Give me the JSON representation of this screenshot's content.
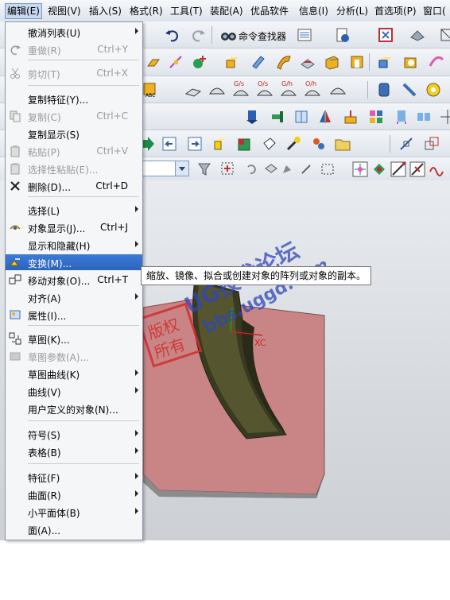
{
  "menubar": {
    "items": [
      "编辑(E)",
      "视图(V)",
      "插入(S)",
      "格式(R)",
      "工具(T)",
      "装配(A)",
      "优品软件",
      "信息(I)",
      "分析(L)",
      "首选项(P)",
      "窗口("
    ]
  },
  "toolbar": {
    "command_finder": "命令查找器"
  },
  "edit_menu": {
    "items": [
      {
        "label": "撤消列表(U)",
        "shortcut": "",
        "submenu": true,
        "disabled": false,
        "icon": ""
      },
      {
        "label": "重做(R)",
        "shortcut": "Ctrl+Y",
        "submenu": false,
        "disabled": true,
        "icon": "redo-icon"
      },
      {
        "label": "剪切(T)",
        "shortcut": "Ctrl+X",
        "submenu": false,
        "disabled": true,
        "icon": "cut-icon"
      },
      {
        "label": "复制特征(Y)...",
        "shortcut": "",
        "submenu": false,
        "disabled": false,
        "icon": ""
      },
      {
        "label": "复制(C)",
        "shortcut": "Ctrl+C",
        "submenu": false,
        "disabled": true,
        "icon": "copy-icon"
      },
      {
        "label": "复制显示(S)",
        "shortcut": "",
        "submenu": false,
        "disabled": false,
        "icon": ""
      },
      {
        "label": "粘贴(P)",
        "shortcut": "Ctrl+V",
        "submenu": false,
        "disabled": true,
        "icon": "paste-icon"
      },
      {
        "label": "选择性粘贴(E)...",
        "shortcut": "",
        "submenu": false,
        "disabled": true,
        "icon": "paste-special-icon"
      },
      {
        "label": "删除(D)...",
        "shortcut": "Ctrl+D",
        "submenu": false,
        "disabled": false,
        "icon": "delete-icon"
      },
      {
        "label": "选择(L)",
        "shortcut": "",
        "submenu": true,
        "disabled": false,
        "icon": ""
      },
      {
        "label": "对象显示(J)...",
        "shortcut": "Ctrl+J",
        "submenu": false,
        "disabled": false,
        "icon": "object-display-icon"
      },
      {
        "label": "显示和隐藏(H)",
        "shortcut": "",
        "submenu": true,
        "disabled": false,
        "icon": ""
      },
      {
        "label": "变换(M)...",
        "shortcut": "",
        "submenu": false,
        "disabled": false,
        "icon": "transform-icon",
        "highlighted": true
      },
      {
        "label": "移动对象(O)...",
        "shortcut": "Ctrl+T",
        "submenu": false,
        "disabled": false,
        "icon": "move-object-icon"
      },
      {
        "label": "对齐(A)",
        "shortcut": "",
        "submenu": true,
        "disabled": false,
        "icon": ""
      },
      {
        "label": "属性(I)...",
        "shortcut": "",
        "submenu": false,
        "disabled": false,
        "icon": "properties-icon"
      },
      {
        "label": "草图(K)...",
        "shortcut": "",
        "submenu": false,
        "disabled": false,
        "icon": "sketch-icon"
      },
      {
        "label": "草图参数(A)...",
        "shortcut": "",
        "submenu": false,
        "disabled": true,
        "icon": "sketch-params-icon"
      },
      {
        "label": "草图曲线(K)",
        "shortcut": "",
        "submenu": true,
        "disabled": false,
        "icon": ""
      },
      {
        "label": "曲线(V)",
        "shortcut": "",
        "submenu": true,
        "disabled": false,
        "icon": ""
      },
      {
        "label": "用户定义的对象(N)...",
        "shortcut": "",
        "submenu": false,
        "disabled": false,
        "icon": ""
      },
      {
        "label": "符号(S)",
        "shortcut": "",
        "submenu": true,
        "disabled": false,
        "icon": ""
      },
      {
        "label": "表格(B)",
        "shortcut": "",
        "submenu": true,
        "disabled": false,
        "icon": ""
      },
      {
        "label": "特征(F)",
        "shortcut": "",
        "submenu": true,
        "disabled": false,
        "icon": ""
      },
      {
        "label": "曲面(R)",
        "shortcut": "",
        "submenu": true,
        "disabled": false,
        "icon": ""
      },
      {
        "label": "小平面体(B)",
        "shortcut": "",
        "submenu": true,
        "disabled": false,
        "icon": ""
      },
      {
        "label": "面(A)...",
        "shortcut": "",
        "submenu": false,
        "disabled": false,
        "icon": ""
      }
    ]
  },
  "tooltip": "缩放、镜像、拟合或创建对象的阵列或对象的副本。",
  "viewport": {
    "axis_label": "XC"
  },
  "watermark": {
    "title": "UG技术论坛",
    "url": "bbs.uggd.com",
    "seal": [
      "版权",
      "所有"
    ]
  },
  "colors": {
    "highlight": "#2f6bc6",
    "part": "#c98586",
    "watermark": "#d22d2d"
  }
}
